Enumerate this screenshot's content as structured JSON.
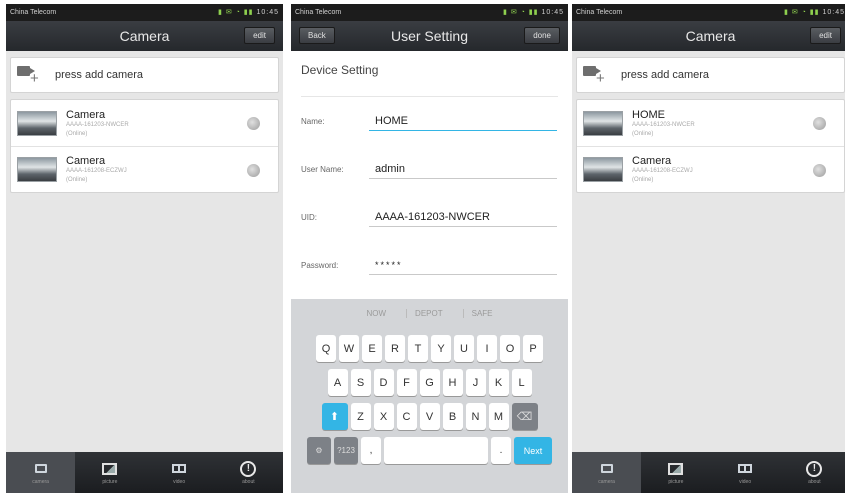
{
  "status": {
    "carrier": "China Telecom",
    "time": "10:45"
  },
  "screen1": {
    "title": "Camera",
    "edit_label": "edit",
    "add_label": "press add camera",
    "cameras": [
      {
        "name": "Camera",
        "uid": "AAAA-161203-NWCER",
        "status": "(Online)"
      },
      {
        "name": "Camera",
        "uid": "AAAA-161208-ECZWJ",
        "status": "(Online)"
      }
    ]
  },
  "screen2": {
    "title": "User Setting",
    "back_label": "Back",
    "done_label": "done",
    "section_title": "Device Setting",
    "fields": [
      {
        "label": "Name:",
        "value": "HOME"
      },
      {
        "label": "User Name:",
        "value": "admin"
      },
      {
        "label": "UID:",
        "value": "AAAA-161203-NWCER"
      },
      {
        "label": "Password:",
        "value": "*****"
      }
    ],
    "suggestions": [
      "NOW",
      "DEPOT",
      "SAFE"
    ],
    "keys_row1": [
      "Q",
      "W",
      "E",
      "R",
      "T",
      "Y",
      "U",
      "I",
      "O",
      "P"
    ],
    "keys_row2": [
      "A",
      "S",
      "D",
      "F",
      "G",
      "H",
      "J",
      "K",
      "L"
    ],
    "keys_row3": [
      "Z",
      "X",
      "C",
      "V",
      "B",
      "N",
      "M"
    ],
    "next_label": "Next",
    "symbols_label": "?123",
    "period_label": "."
  },
  "screen3": {
    "title": "Camera",
    "edit_label": "edit",
    "add_label": "press add camera",
    "cameras": [
      {
        "name": "HOME",
        "uid": "AAAA-161203-NWCER",
        "status": "(Online)"
      },
      {
        "name": "Camera",
        "uid": "AAAA-161208-ECZWJ",
        "status": "(Online)"
      }
    ]
  },
  "tabs": [
    {
      "icon": "camera-list-icon",
      "label": "camera"
    },
    {
      "icon": "picture-icon",
      "label": "picture"
    },
    {
      "icon": "video-icon",
      "label": "video"
    },
    {
      "icon": "info-icon",
      "label": "about"
    }
  ]
}
